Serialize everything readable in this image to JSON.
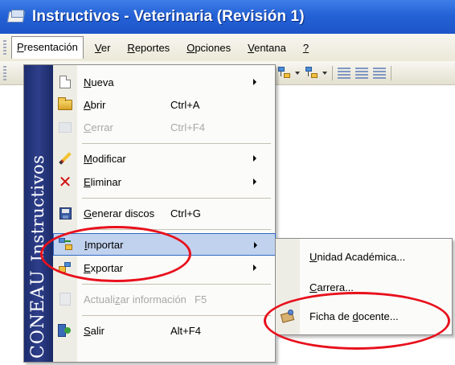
{
  "window": {
    "title": "Instructivos - Veterinaria (Revisión 1)"
  },
  "menubar": {
    "items": [
      {
        "label": "Presentación",
        "ul_index": 0
      },
      {
        "label": "Ver",
        "ul_index": 0
      },
      {
        "label": "Reportes",
        "ul_index": 0
      },
      {
        "label": "Opciones",
        "ul_index": 0
      },
      {
        "label": "Ventana",
        "ul_index": 0
      },
      {
        "label": "?",
        "ul_index": 0
      }
    ]
  },
  "banner": {
    "org": "CONEAU",
    "product": "Instructivos"
  },
  "presentacion_menu": {
    "items": [
      {
        "label": "Nueva",
        "shortcut": "",
        "icon": "new-document-icon",
        "submenu": true,
        "enabled": true
      },
      {
        "label": "Abrir",
        "shortcut": "Ctrl+A",
        "icon": "open-folder-icon",
        "submenu": false,
        "enabled": true
      },
      {
        "label": "Cerrar",
        "shortcut": "Ctrl+F4",
        "icon": "close-document-icon",
        "submenu": false,
        "enabled": false
      },
      {
        "label": "Modificar",
        "shortcut": "",
        "icon": "pencil-icon",
        "submenu": true,
        "enabled": true
      },
      {
        "label": "Eliminar",
        "shortcut": "",
        "icon": "delete-x-icon",
        "submenu": true,
        "enabled": true
      },
      {
        "label": "Generar discos",
        "shortcut": "Ctrl+G",
        "icon": "floppy-disk-icon",
        "submenu": false,
        "enabled": true
      },
      {
        "label": "Importar",
        "shortcut": "",
        "icon": "import-icon",
        "submenu": true,
        "enabled": true,
        "highlighted": true
      },
      {
        "label": "Exportar",
        "shortcut": "",
        "icon": "export-icon",
        "submenu": true,
        "enabled": true
      },
      {
        "label": "Actualizar información",
        "shortcut": "F5",
        "icon": "update-icon",
        "submenu": false,
        "enabled": false
      },
      {
        "label": "Salir",
        "shortcut": "Alt+F4",
        "icon": "exit-door-icon",
        "submenu": false,
        "enabled": true
      }
    ]
  },
  "importar_submenu": {
    "items": [
      {
        "label": "Unidad Académica...",
        "icon": ""
      },
      {
        "label": "Carrera...",
        "icon": ""
      },
      {
        "label": "Ficha de docente...",
        "icon": "teacher-card-icon"
      }
    ]
  },
  "annotations": {
    "color": "#e8101c",
    "highlight_color": "#c1d2ee",
    "titlebar_color": "#2462d6",
    "banner_color": "#1d2c6e"
  }
}
